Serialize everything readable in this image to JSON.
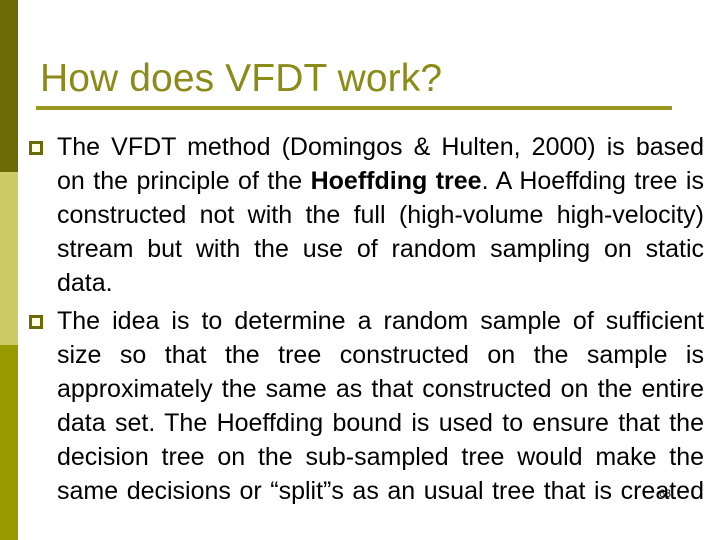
{
  "slide": {
    "title": "How does VFDT work?",
    "page_number": "63",
    "colors": {
      "title_text": "#8B8B1A",
      "title_rule": "#99991F",
      "sidebar_top": "#6B6B06",
      "sidebar_middle": "#CCCC66",
      "sidebar_bottom": "#999900",
      "bullet_marker": "#6B6B06",
      "body_text": "#000000",
      "background": "#FFFFFF"
    },
    "sidebar_segments": [
      {
        "name": "sidebar-segment-top",
        "color": "#6B6B06"
      },
      {
        "name": "sidebar-segment-middle",
        "color": "#CCCC66"
      },
      {
        "name": "sidebar-segment-bottom",
        "color": "#999900"
      }
    ],
    "bullets": [
      {
        "marker": "hollow-square-bullet",
        "part_1": "The VFDT method (Domingos & Hulten, 2000) is based on the principle of the ",
        "bold": "Hoeffding tree",
        "part_2": ". A Hoeffding tree is constructed not with the full (high-volume high-velocity) stream but with the use of random sampling on static data."
      },
      {
        "marker": "hollow-square-bullet",
        "part_1": "The idea is to determine a random sample of sufficient size so that the tree constructed on the sample is approximately the same as that constructed on the entire data set. The Hoeffding bound is used to ensure that the decision tree on the sub-sampled tree would make the same decisions or “split”s as an usual tree that is created",
        "bold": "",
        "part_2": ""
      }
    ]
  }
}
